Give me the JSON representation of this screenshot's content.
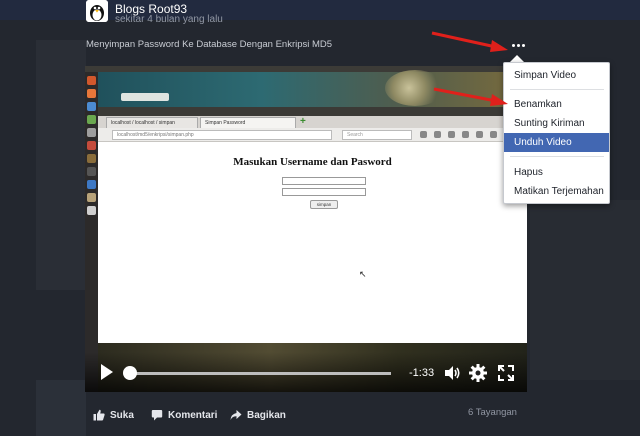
{
  "post": {
    "author": "Blogs Root93",
    "time": "sekitar 4 bulan yang lalu",
    "caption": "Menyimpan Password Ke Database Dengan Enkripsi MD5"
  },
  "video_content": {
    "tabs": [
      "localhost / localhost / simpan",
      "Simpan Password"
    ],
    "url": "localhost/md5/enkripsi/simpan.php",
    "search_placeholder": "Search",
    "form_title": "Masukan Username dan Pasword",
    "form_button": "simpan"
  },
  "player": {
    "remaining_time": "-1:33",
    "progress": 0.01,
    "icons": [
      "play-icon",
      "volume-icon",
      "gear-icon",
      "fullscreen-icon"
    ]
  },
  "actions": {
    "like": "Suka",
    "comment": "Komentari",
    "share": "Bagikan",
    "views": "6 Tayangan"
  },
  "menu": {
    "items": [
      {
        "label": "Simpan Video",
        "highlighted": false
      },
      {
        "label": "Benamkan",
        "highlighted": false
      },
      {
        "label": "Sunting Kiriman",
        "highlighted": false
      },
      {
        "label": "Unduh Video",
        "highlighted": true
      },
      {
        "label": "Hapus",
        "highlighted": false
      },
      {
        "label": "Matikan Terjemahan",
        "highlighted": false
      }
    ]
  },
  "colors": {
    "highlight": "#4267b2",
    "annotation_arrow": "#e0201b",
    "background": "#1d2129"
  }
}
